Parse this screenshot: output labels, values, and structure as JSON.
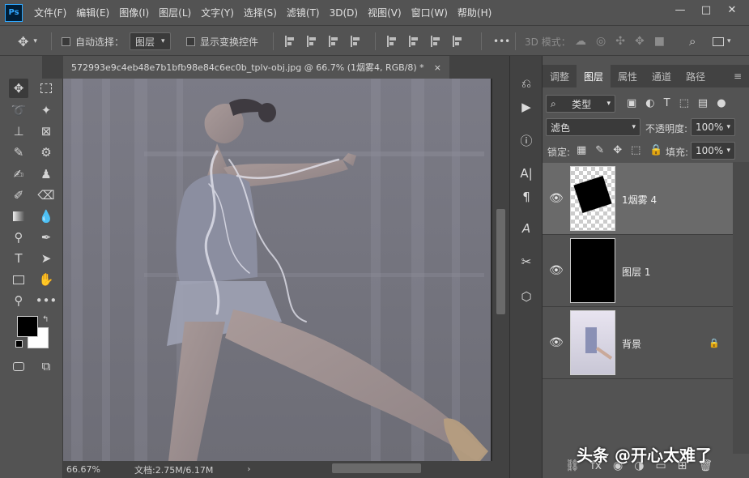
{
  "app": {
    "logo": "Ps"
  },
  "menu": [
    "文件(F)",
    "编辑(E)",
    "图像(I)",
    "图层(L)",
    "文字(Y)",
    "选择(S)",
    "滤镜(T)",
    "3D(D)",
    "视图(V)",
    "窗口(W)",
    "帮助(H)"
  ],
  "window_controls": {
    "minimize": "—",
    "maximize": "□",
    "close": "✕"
  },
  "options_bar": {
    "auto_select_label": "自动选择：",
    "auto_select_target": "图层",
    "show_transform_label": "显示变换控件",
    "mode_3d_label": "3D 模式：",
    "more_label": "•••"
  },
  "document": {
    "tab_title": "572993e9c4eb48e7b1bfb98e84c6ec0b_tplv-obj.jpg @ 66.7% (1烟雾4, RGB/8) *",
    "close": "×",
    "zoom": "66.67%",
    "doc_info": "文档:2.75M/6.17M"
  },
  "panel": {
    "tabs": [
      "调整",
      "图层",
      "属性",
      "通道",
      "路径"
    ],
    "active_tab": "图层",
    "filter_kind": "类型",
    "blend_mode": "滤色",
    "opacity_label": "不透明度:",
    "opacity_value": "100%",
    "lock_label": "锁定:",
    "fill_label": "填充:",
    "fill_value": "100%"
  },
  "layers": [
    {
      "name": "1烟雾 4",
      "visible": true,
      "selected": true,
      "thumb": "smoke"
    },
    {
      "name": "图层 1",
      "visible": true,
      "selected": false,
      "thumb": "black"
    },
    {
      "name": "背景",
      "visible": true,
      "selected": false,
      "thumb": "photo",
      "locked": true
    }
  ],
  "watermark": "头条 @开心太难了",
  "colors": {
    "ui_bg": "#535353",
    "ui_dark": "#424242",
    "accent_ps": "#31a8ff",
    "foreground_color": "#000000",
    "background_color": "#ffffff"
  }
}
